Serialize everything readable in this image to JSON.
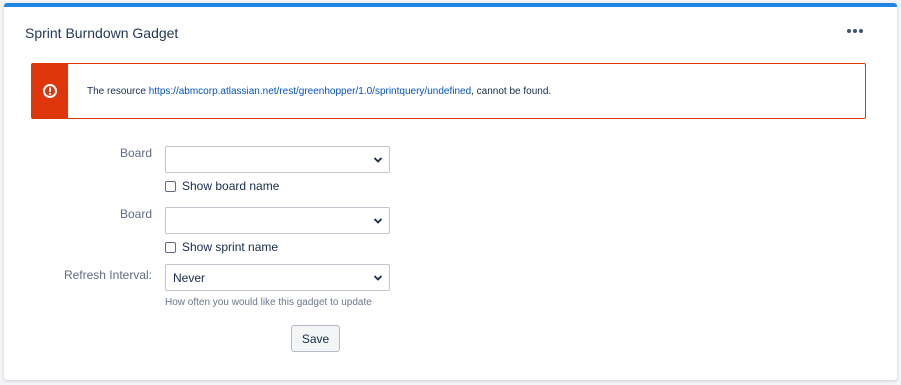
{
  "gadget": {
    "title": "Sprint Burndown Gadget",
    "menu_icon": "more-horizontal-icon"
  },
  "alert": {
    "icon": "error-icon",
    "prefix": "The resource",
    "link": "https://abmcorp.atlassian.net/rest/greenhopper/1.0/sprintquery/undefined",
    "suffix": ", cannot be found.",
    "accent_color": "#de350b"
  },
  "form": {
    "board1": {
      "label": "Board",
      "value": ""
    },
    "show_board_name": {
      "label": "Show board name",
      "checked": false
    },
    "board2": {
      "label": "Board",
      "value": ""
    },
    "show_sprint_name": {
      "label": "Show sprint name",
      "checked": false
    },
    "refresh": {
      "label": "Refresh Interval:",
      "value": "Never",
      "help": "How often you would like this gadget to update"
    },
    "save_label": "Save"
  },
  "colors": {
    "accent_top": "#1f86e6",
    "link": "#0052cc"
  }
}
